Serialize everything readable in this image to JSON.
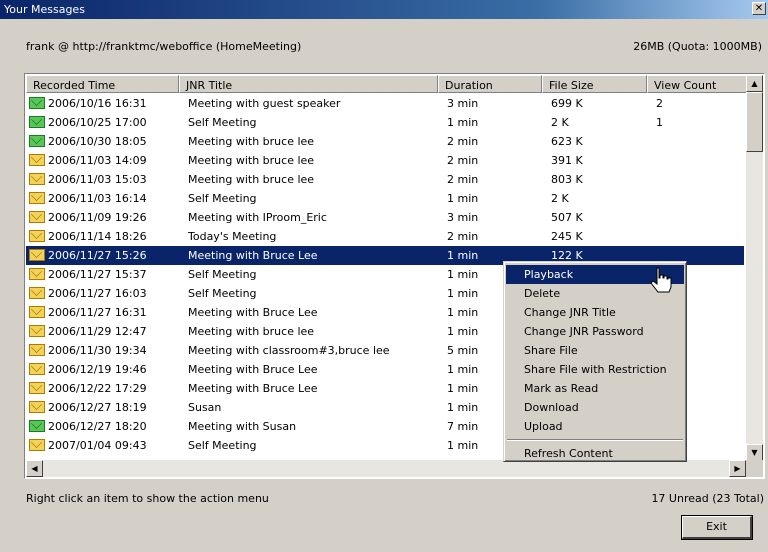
{
  "window": {
    "title": "Your Messages",
    "close_label": "✕"
  },
  "account": "frank @ http://franktmc/weboffice (HomeMeeting)",
  "quota": "26MB (Quota: 1000MB)",
  "columns": [
    "Recorded Time",
    "JNR Title",
    "Duration",
    "File Size",
    "View Count"
  ],
  "rows": [
    {
      "time": "2006/10/16 16:31",
      "title": "Meeting with guest speaker",
      "duration": "3 min",
      "size": "699 K",
      "views": "2",
      "icon": "read"
    },
    {
      "time": "2006/10/25 17:00",
      "title": "Self Meeting",
      "duration": "1 min",
      "size": "2 K",
      "views": "1",
      "icon": "read"
    },
    {
      "time": "2006/10/30 18:05",
      "title": "Meeting with bruce lee",
      "duration": "2 min",
      "size": "623 K",
      "views": "",
      "icon": "read"
    },
    {
      "time": "2006/11/03 14:09",
      "title": "Meeting with bruce lee",
      "duration": "2 min",
      "size": "391 K",
      "views": "",
      "icon": "unread"
    },
    {
      "time": "2006/11/03 15:03",
      "title": "Meeting with bruce lee",
      "duration": "2 min",
      "size": "803 K",
      "views": "",
      "icon": "unread"
    },
    {
      "time": "2006/11/03 16:14",
      "title": "Self Meeting",
      "duration": "1 min",
      "size": "2 K",
      "views": "",
      "icon": "unread"
    },
    {
      "time": "2006/11/09 19:26",
      "title": "Meeting with IProom_Eric",
      "duration": "3 min",
      "size": "507 K",
      "views": "",
      "icon": "unread"
    },
    {
      "time": "2006/11/14 18:26",
      "title": "Today's Meeting",
      "duration": "2 min",
      "size": "245 K",
      "views": "",
      "icon": "unread"
    },
    {
      "time": "2006/11/27 15:26",
      "title": "Meeting with Bruce Lee",
      "duration": "1 min",
      "size": "122 K",
      "views": "",
      "icon": "unread",
      "selected": true
    },
    {
      "time": "2006/11/27 15:37",
      "title": "Self Meeting",
      "duration": "1 min",
      "size": "",
      "views": "",
      "icon": "unread"
    },
    {
      "time": "2006/11/27 16:03",
      "title": "Self Meeting",
      "duration": "1 min",
      "size": "",
      "views": "",
      "icon": "unread"
    },
    {
      "time": "2006/11/27 16:31",
      "title": "Meeting with Bruce Lee",
      "duration": "1 min",
      "size": "",
      "views": "",
      "icon": "unread"
    },
    {
      "time": "2006/11/29 12:47",
      "title": "Meeting with bruce lee",
      "duration": "1 min",
      "size": "",
      "views": "",
      "icon": "unread"
    },
    {
      "time": "2006/11/30 19:34",
      "title": "Meeting with classroom#3,bruce lee",
      "duration": "5 min",
      "size": "",
      "views": "",
      "icon": "unread"
    },
    {
      "time": "2006/12/19 19:46",
      "title": "Meeting with Bruce Lee",
      "duration": "1 min",
      "size": "",
      "views": "",
      "icon": "unread"
    },
    {
      "time": "2006/12/22 17:29",
      "title": "Meeting with Bruce Lee",
      "duration": "1 min",
      "size": "",
      "views": "",
      "icon": "unread"
    },
    {
      "time": "2006/12/27 18:19",
      "title": "Susan",
      "duration": "1 min",
      "size": "",
      "views": "",
      "icon": "unread"
    },
    {
      "time": "2006/12/27 18:20",
      "title": "Meeting with Susan",
      "duration": "7 min",
      "size": "",
      "views": "",
      "icon": "read"
    },
    {
      "time": "2007/01/04 09:43",
      "title": "Self Meeting",
      "duration": "1 min",
      "size": "",
      "views": "",
      "icon": "unread"
    }
  ],
  "context_menu": [
    {
      "label": "Playback",
      "highlighted": true
    },
    {
      "label": "Delete"
    },
    {
      "label": "Change JNR Title"
    },
    {
      "label": "Change JNR Password"
    },
    {
      "label": "Share File"
    },
    {
      "label": "Share File with Restriction"
    },
    {
      "label": "Mark as Read"
    },
    {
      "label": "Download"
    },
    {
      "label": "Upload"
    },
    {
      "separator": true
    },
    {
      "label": "Refresh Content"
    }
  ],
  "hint": "Right click an item to show the action menu",
  "unread_status": "17 Unread (23 Total)",
  "exit_label": "Exit",
  "icons": {
    "unread": "envelope-closed-icon",
    "read": "envelope-open-icon"
  }
}
